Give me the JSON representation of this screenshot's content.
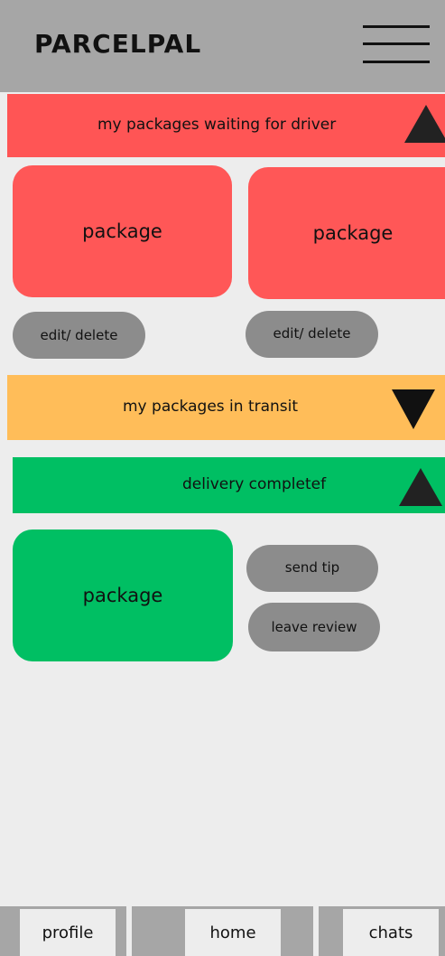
{
  "app": {
    "title": "PARCELPAL"
  },
  "header": {
    "menu_icon": "hamburger-menu-icon"
  },
  "sections": {
    "waiting": {
      "title": "my packages waiting for driver",
      "toggle_icon": "triangle-up-icon",
      "color": "#ff5555",
      "packages": [
        {
          "label": "package",
          "action": "edit/ delete"
        },
        {
          "label": "package",
          "action": "edit/ delete"
        }
      ]
    },
    "transit": {
      "title": "my packages in transit",
      "toggle_icon": "triangle-down-icon",
      "color": "#ffbd59"
    },
    "completed": {
      "title": "delivery completef",
      "toggle_icon": "triangle-up-icon",
      "color": "#00bf63",
      "packages": [
        {
          "label": "package",
          "actions": [
            "send tip",
            "leave review"
          ]
        }
      ]
    }
  },
  "nav": {
    "profile": "profile",
    "home": "home",
    "chats": "chats"
  }
}
